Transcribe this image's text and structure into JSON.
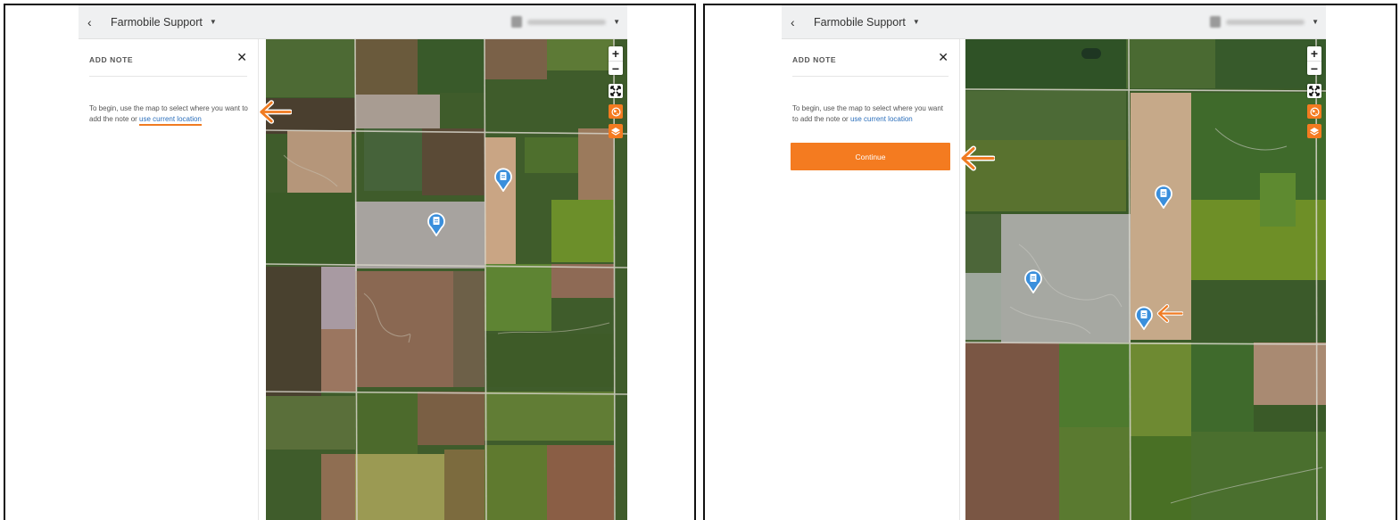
{
  "colors": {
    "accent": "#f47b20",
    "link": "#2a6ebb",
    "pin": "#3a8fdc",
    "topbar": "#eff0f1"
  },
  "panels": [
    {
      "header": {
        "back_icon": "chevron-left-icon",
        "org_name": "Farmobile Support",
        "org_caret": "caret-down-icon"
      },
      "sidebar": {
        "title": "ADD NOTE",
        "close_icon": "close-icon",
        "instructions_text": "To begin, use the map to select where you want to add the note or ",
        "location_link": "use current location"
      },
      "map": {
        "controls": [
          "zoom-in-icon",
          "zoom-out-icon",
          "fullscreen-icon",
          "globe-icon",
          "layers-icon"
        ],
        "zoom_in_label": "+",
        "zoom_out_label": "−",
        "pins": [
          "note-pin-icon",
          "note-pin-icon"
        ]
      },
      "annotation_arrow": "arrow-left-icon"
    },
    {
      "header": {
        "back_icon": "chevron-left-icon",
        "org_name": "Farmobile Support",
        "org_caret": "caret-down-icon"
      },
      "sidebar": {
        "title": "ADD NOTE",
        "close_icon": "close-icon",
        "instructions_text": "To begin, use the map to select where you want to add the note or ",
        "location_link": "use current location",
        "continue_label": "Continue"
      },
      "map": {
        "controls": [
          "zoom-in-icon",
          "zoom-out-icon",
          "fullscreen-icon",
          "globe-icon",
          "layers-icon"
        ],
        "zoom_in_label": "+",
        "zoom_out_label": "−",
        "pins": [
          "note-pin-icon",
          "note-pin-icon",
          "note-pin-icon"
        ]
      },
      "annotation_arrows": [
        "arrow-left-icon",
        "arrow-left-icon"
      ]
    }
  ]
}
